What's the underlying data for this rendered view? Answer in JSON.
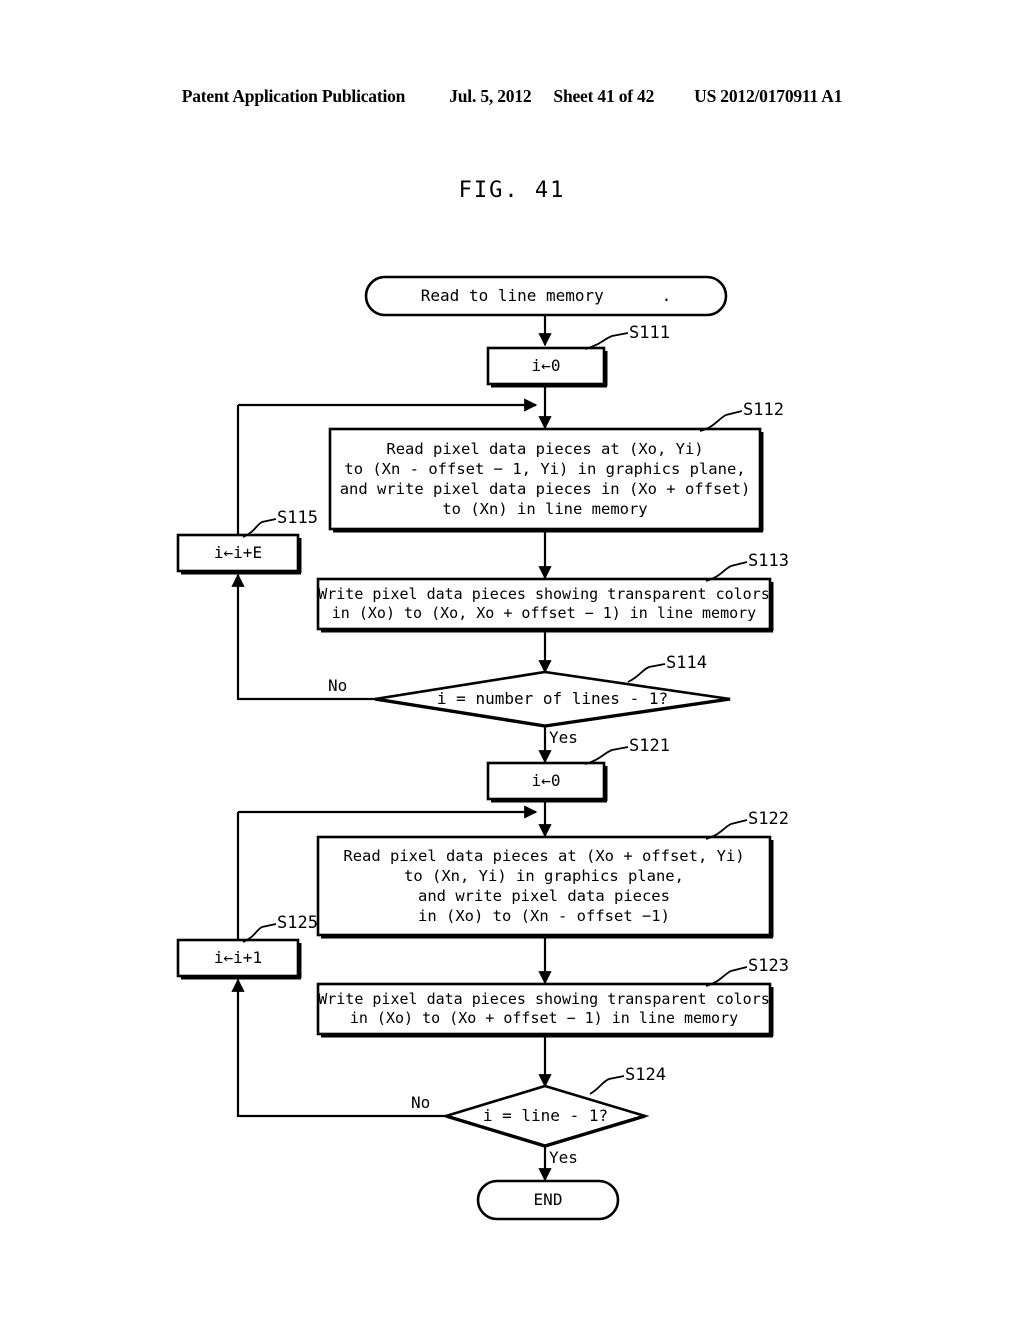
{
  "header": {
    "publication": "Patent Application Publication",
    "date": "Jul. 5, 2012",
    "sheet": "Sheet 41 of 42",
    "number": "US 2012/0170911 A1"
  },
  "figure": {
    "title": "FIG. 41"
  },
  "flowchart": {
    "nodes": {
      "start": {
        "shape": "terminator",
        "label": "Read to line memory      ."
      },
      "s111": {
        "shape": "process",
        "step": "S111",
        "label": "i←0"
      },
      "s112": {
        "shape": "process",
        "step": "S112",
        "line1": "Read pixel data pieces at (Xo, Yi)",
        "line2": "to (Xn - offset − 1, Yi) in graphics plane,",
        "line3": "and write pixel data pieces in (Xo + offset)",
        "line4": "to (Xn) in line memory"
      },
      "s113": {
        "shape": "process",
        "step": "S113",
        "line1": "Write pixel data pieces showing transparent colors",
        "line2": "in (Xo) to (Xo, Xo + offset − 1) in line memory"
      },
      "s114": {
        "shape": "decision",
        "step": "S114",
        "label": "i = number of lines - 1?",
        "no_label": "No",
        "yes_label": "Yes"
      },
      "s115": {
        "shape": "process",
        "step": "S115",
        "label": "i←i+E"
      },
      "s121": {
        "shape": "process",
        "step": "S121",
        "label": "i←0"
      },
      "s122": {
        "shape": "process",
        "step": "S122",
        "line1": "Read pixel data pieces at (Xo + offset, Yi)",
        "line2": "to (Xn, Yi) in graphics plane,",
        "line3": "and write pixel data pieces",
        "line4": "in (Xo) to (Xn - offset −1)"
      },
      "s123": {
        "shape": "process",
        "step": "S123",
        "line1": "Write pixel data pieces showing transparent colors",
        "line2": "in (Xo) to (Xo + offset − 1) in line memory"
      },
      "s124": {
        "shape": "decision",
        "step": "S124",
        "label": "i = line - 1?",
        "no_label": "No",
        "yes_label": "Yes"
      },
      "s125": {
        "shape": "process",
        "step": "S125",
        "label": "i←i+1"
      },
      "end": {
        "shape": "terminator",
        "label": "END"
      }
    }
  },
  "colors": {
    "ink": "#000000",
    "paper": "#ffffff"
  }
}
